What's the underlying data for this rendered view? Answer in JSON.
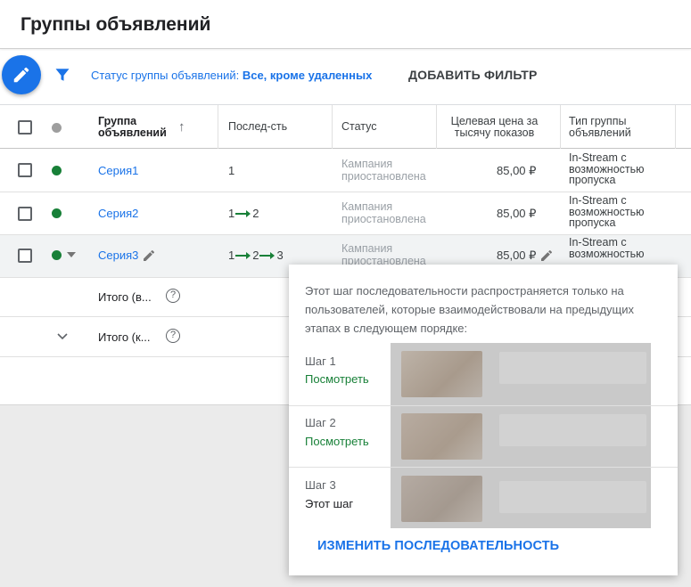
{
  "page": {
    "title": "Группы объявлений"
  },
  "toolbar": {
    "filter_prefix": "Статус группы объявлений: ",
    "filter_value": "Все, кроме удаленных",
    "add_filter": "ДОБАВИТЬ ФИЛЬТР"
  },
  "table": {
    "headers": {
      "ad_group": "Группа объявлений",
      "sort_arrow": "↑",
      "sequence": "Послед-сть",
      "status": "Статус",
      "target_cpm": "Целевая цена за тысячу показов",
      "type": "Тип группы объявлений"
    },
    "rows": [
      {
        "name": "Серия1",
        "sequence": "1",
        "status": "Кампания приостановлена",
        "cpm": "85,00 ₽",
        "type": "In-Stream с возможностью пропуска"
      },
      {
        "name": "Серия2",
        "sequence": "1 → 2",
        "status": "Кампания приостановлена",
        "cpm": "85,00 ₽",
        "type": "In-Stream с возможностью пропуска"
      },
      {
        "name": "Серия3",
        "sequence": "1 → 2 → 3",
        "status": "Кампания приостановлена",
        "cpm": "85,00 ₽",
        "type": "In-Stream с возможностью"
      }
    ],
    "seq_parts": [
      "1",
      "2",
      "3"
    ],
    "totals": [
      {
        "label": "Итого (в..."
      },
      {
        "label": "Итого (к..."
      }
    ]
  },
  "popup": {
    "description": "Этот шаг последовательности распространяется только на пользователей, которые взаимодействовали на предыдущих этапах в следующем порядке:",
    "steps": [
      {
        "label": "Шаг 1",
        "action": "Посмотреть"
      },
      {
        "label": "Шаг 2",
        "action": "Посмотреть"
      },
      {
        "label": "Шаг 3",
        "action": "Этот шаг"
      }
    ],
    "change_button": "ИЗМЕНИТЬ ПОСЛЕДОВАТЕЛЬНОСТЬ"
  },
  "colors": {
    "accent": "#1a73e8",
    "status_green": "#188038",
    "arrow_green": "#188038"
  }
}
